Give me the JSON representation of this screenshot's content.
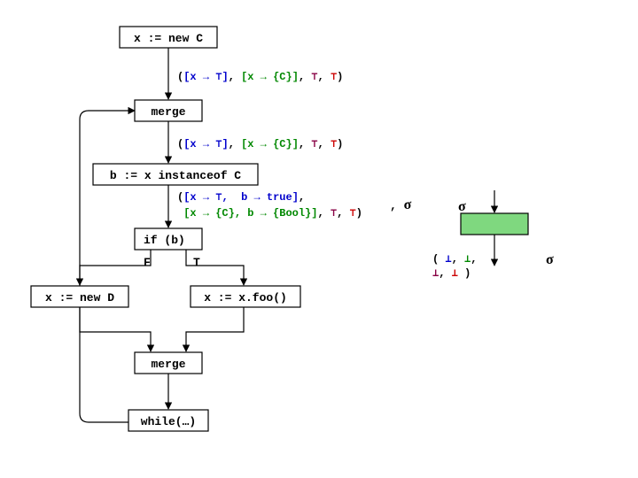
{
  "nodes": {
    "n1": "x := new C",
    "n2": "merge",
    "n3": "b := x instanceof C",
    "n4": "if (b)",
    "n5": "x := new D",
    "n6": "x := x.foo()",
    "n7": "merge",
    "n8": "while(…)"
  },
  "branch": {
    "F": "F",
    "T": "T"
  },
  "state1": {
    "open": "(",
    "lb1": "[",
    "x1": "x ",
    "arr1": "→ ",
    "top1": "⊤",
    "rb1": "]",
    "c1": ", ",
    "lb2": "[",
    "x2": "x ",
    "arr2": "→ ",
    "set2": "{C}",
    "rb2": "]",
    "c2": ", ",
    "top2": "⊤",
    "c3": ", ",
    "top3": "⊤",
    "close": ")"
  },
  "state2": {
    "open": "(",
    "lb1": "[",
    "x1": "x ",
    "arr1": "→ ",
    "top1": "⊤",
    "rb1": "]",
    "c1": ", ",
    "lb2": "[",
    "x2": "x ",
    "arr2": "→ ",
    "set2": "{C}",
    "rb2": "]",
    "c2": ", ",
    "top2": "⊤",
    "c3": ", ",
    "top3": "⊤",
    "close": ")"
  },
  "state3": {
    "l1": {
      "open": "(",
      "lb": "[",
      "x": "x ",
      "arr": "→ ",
      "top": "⊤",
      "comma": ",",
      "sp": "  ",
      "b": "b ",
      "arr2": "→ ",
      "true": "true",
      "rb": "]",
      "c": ","
    },
    "l2": {
      "sp": " ",
      "lb": "[",
      "x": "x ",
      "arr": "→ ",
      "set": "{C}",
      "comma": ",",
      "b": " b ",
      "arr2": "→ ",
      "bool": "{Bool}",
      "rb": "]",
      "c1": ", ",
      "top1": "⊤",
      "c2": ", ",
      "top2": "⊤",
      "close": ")"
    }
  },
  "side": {
    "comma": ", ",
    "sigma1": "σ",
    "sigma2": "σ",
    "sigma3": "σ",
    "bots": {
      "open": "( ",
      "b1": "⊥",
      "c1": ", ",
      "b2": "⊥",
      "c2": ",",
      "b3": "⊥",
      "c3": ", ",
      "b4": "⊥",
      "close": " )"
    }
  },
  "key": {
    "open": "( ",
    "close": " )",
    "b1": "⊥",
    "b2": "⊥",
    "b3": "⊥",
    "b4": "⊥",
    "comma": ", "
  },
  "chart_data": {
    "type": "diagram",
    "description": "Control-flow graph with abstract states",
    "nodes": [
      {
        "id": "n1",
        "label": "x := new C"
      },
      {
        "id": "n2",
        "label": "merge"
      },
      {
        "id": "n3",
        "label": "b := x instanceof C"
      },
      {
        "id": "n4",
        "label": "if (b)"
      },
      {
        "id": "n5",
        "label": "x := new D"
      },
      {
        "id": "n6",
        "label": "x := x.foo()"
      },
      {
        "id": "n7",
        "label": "merge"
      },
      {
        "id": "n8",
        "label": "while(…)"
      }
    ],
    "edges": [
      {
        "from": "n1",
        "to": "n2"
      },
      {
        "from": "n2",
        "to": "n3"
      },
      {
        "from": "n3",
        "to": "n4"
      },
      {
        "from": "n4",
        "to": "n5",
        "label": "F"
      },
      {
        "from": "n4",
        "to": "n6",
        "label": "T"
      },
      {
        "from": "n5",
        "to": "n7"
      },
      {
        "from": "n6",
        "to": "n7"
      },
      {
        "from": "n7",
        "to": "n8"
      },
      {
        "from": "n8",
        "to": "n2",
        "kind": "back"
      }
    ],
    "edge_states": [
      {
        "after": "n1",
        "state": "([x → ⊤], [x → {C}], ⊤, ⊤)"
      },
      {
        "after": "n2",
        "state": "([x → ⊤], [x → {C}], ⊤, ⊤)"
      },
      {
        "after": "n3",
        "state": "([x → ⊤, b → true], [x → {C}, b → {Bool}], ⊤, ⊤), σ"
      }
    ],
    "side_box": {
      "input": "σ",
      "output": "σ",
      "below": "( ⊥, ⊥, ⊥, ⊥ )"
    }
  }
}
